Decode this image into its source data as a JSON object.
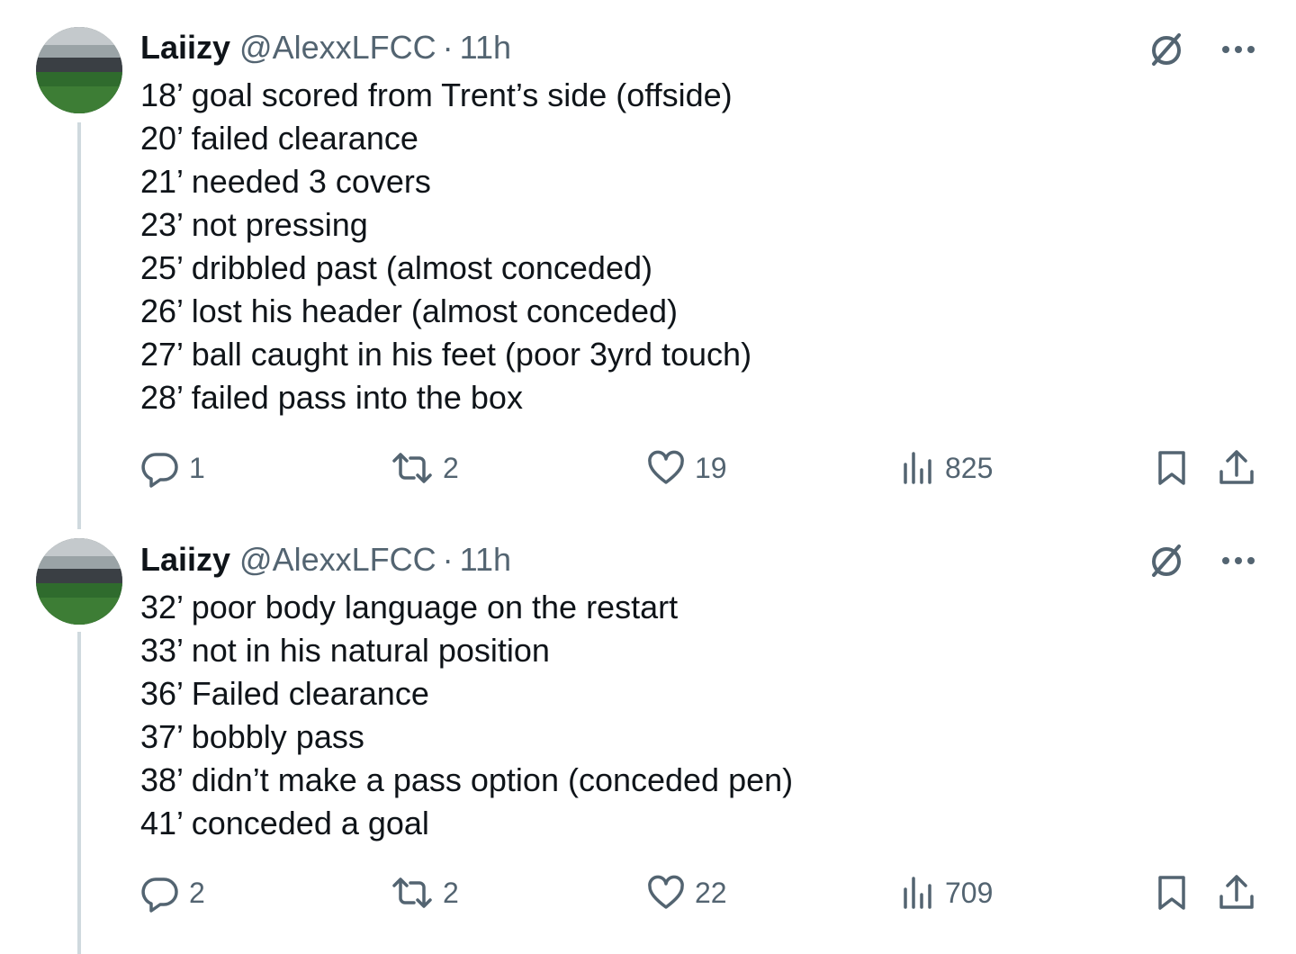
{
  "tweets": [
    {
      "author_name": "Laiizy",
      "handle": "@AlexxLFCC",
      "separator": "·",
      "time": "11h",
      "lines": [
        "18’ goal scored from Trent’s side (offside)",
        "20’ failed clearance",
        "21’ needed 3 covers",
        "23’ not pressing",
        "25’ dribbled past (almost conceded)",
        "26’ lost his header (almost conceded)",
        "27’ ball caught in his feet (poor 3yrd touch)",
        "28’ failed pass into the box"
      ],
      "replies": "1",
      "reposts": "2",
      "likes": "19",
      "views": "825"
    },
    {
      "author_name": "Laiizy",
      "handle": "@AlexxLFCC",
      "separator": "·",
      "time": "11h",
      "lines": [
        "32’ poor body language on the restart",
        "33’ not in his natural position",
        "36’ Failed clearance",
        "37’ bobbly pass",
        "38’ didn’t make a pass option (conceded pen)",
        "41’ conceded a goal"
      ],
      "replies": "2",
      "reposts": "2",
      "likes": "22",
      "views": "709"
    }
  ],
  "icons": {
    "grok": "grok-icon",
    "more": "more-icon",
    "reply": "reply-icon",
    "repost": "repost-icon",
    "like": "like-icon",
    "views": "views-icon",
    "bookmark": "bookmark-icon",
    "share": "share-icon"
  },
  "colors": {
    "text": "#0f1419",
    "secondary": "#536471",
    "thread_line": "#cfd9de"
  }
}
